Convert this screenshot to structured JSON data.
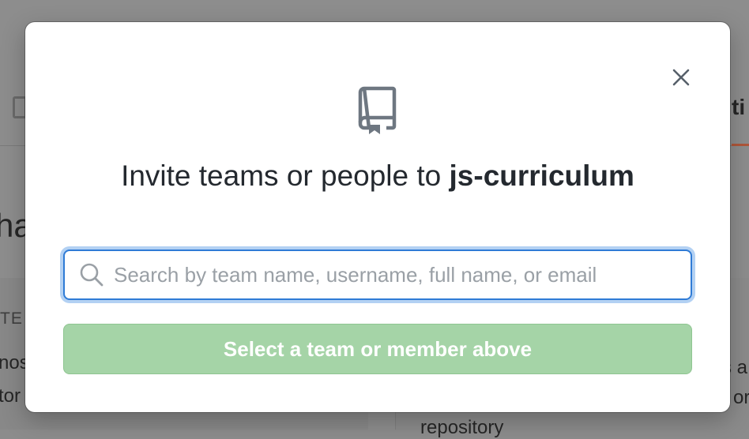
{
  "background": {
    "tab_fragment_right": "ti",
    "heading_fragment": "ha",
    "section_caps_fragment": "TE",
    "line1_fragment": "nos",
    "line2_fragment": "tor",
    "right_fragment_1": "s a",
    "right_fragment_2": "or",
    "repo_fragment": "repository"
  },
  "modal": {
    "icon": "repo-icon",
    "title_prefix": "Invite teams or people to ",
    "repo_name": "js-curriculum",
    "search": {
      "placeholder": "Search by team name, username, full name, or email",
      "value": "",
      "icon": "search-icon"
    },
    "submit_label": "Select a team or member above",
    "close_icon": "close-icon"
  },
  "colors": {
    "accent": "#2f7bd6",
    "submit_disabled_bg": "#a5d4a7",
    "text": "#24292f"
  }
}
